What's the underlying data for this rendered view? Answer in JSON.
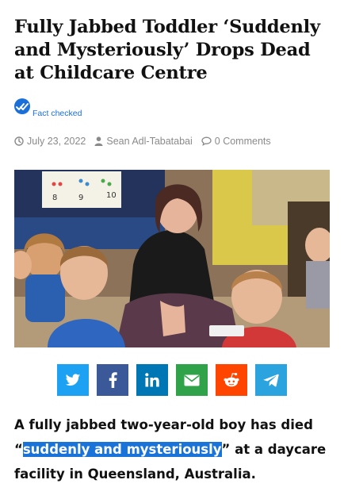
{
  "article": {
    "title": "Fully Jabbed Toddler ‘Suddenly and Mysteriously’ Drops Dead at Childcare Centre",
    "fact_check_label": "Fact checked",
    "date": "July 23, 2022",
    "author": "Sean Adl-Tabatabai",
    "comments": "0 Comments",
    "lead_part1": "A fully jabbed two-year-old boy has died “",
    "lead_highlight": "suddenly and mysteriously",
    "lead_part2": "” at a daycare facility in Queensland, Australia.",
    "photo_chart_numbers": [
      "8",
      "9",
      "10"
    ]
  },
  "share_buttons": [
    {
      "network": "twitter",
      "icon": "twitter-bird-icon",
      "color": "#1da1f2"
    },
    {
      "network": "facebook",
      "icon": "facebook-f-icon",
      "color": "#3b5998"
    },
    {
      "network": "linkedin",
      "icon": "linkedin-in-icon",
      "color": "#0077b5"
    },
    {
      "network": "email",
      "icon": "envelope-icon",
      "color": "#30a24a"
    },
    {
      "network": "reddit",
      "icon": "reddit-alien-icon",
      "color": "#ff4500"
    },
    {
      "network": "telegram",
      "icon": "paper-plane-icon",
      "color": "#2aa3de"
    }
  ],
  "colors": {
    "accent": "#1a6fd8",
    "highlight": "#1a73d9",
    "meta_text": "#8a8a8a"
  }
}
